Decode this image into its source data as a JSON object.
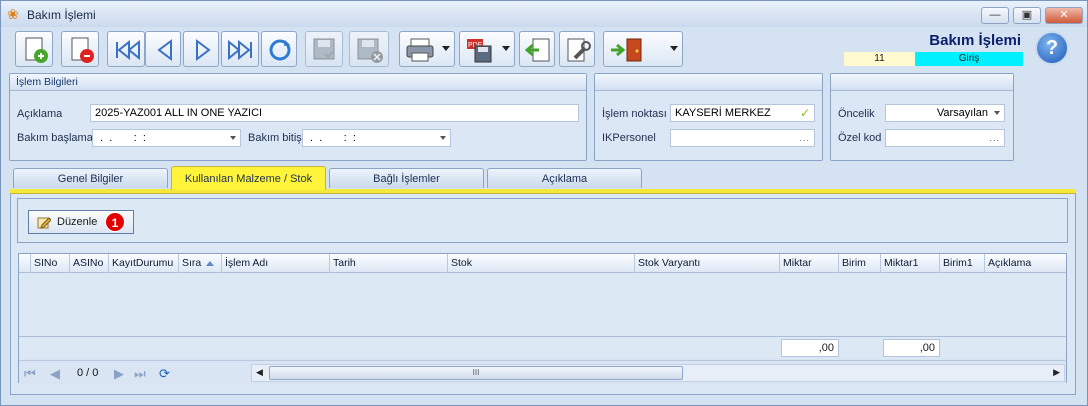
{
  "window": {
    "title": "Bakım İşlemi",
    "controls": [
      "minimize-icon",
      "maximize-icon",
      "close-icon"
    ]
  },
  "toolbar": {
    "buttons": [
      {
        "name": "new-record-button",
        "icon": "page-add-icon"
      },
      {
        "name": "delete-record-button",
        "icon": "page-delete-icon"
      },
      {
        "name": "first-record-button",
        "icon": "first-icon"
      },
      {
        "name": "previous-record-button",
        "icon": "previous-icon"
      },
      {
        "name": "next-record-button",
        "icon": "next-icon"
      },
      {
        "name": "last-record-button",
        "icon": "last-icon"
      },
      {
        "name": "refresh-button",
        "icon": "refresh-icon"
      },
      {
        "name": "save-button",
        "icon": "save-icon"
      },
      {
        "name": "save-close-button",
        "icon": "save-cancel-icon"
      },
      {
        "name": "print-button",
        "icon": "printer-icon"
      },
      {
        "name": "export-pdf-button",
        "icon": "pdf-icon"
      },
      {
        "name": "import-button",
        "icon": "import-icon"
      },
      {
        "name": "tools-button",
        "icon": "wrench-icon"
      },
      {
        "name": "exit-button",
        "icon": "exit-door-icon"
      }
    ]
  },
  "header": {
    "screen_name": "Bakım İşlemi",
    "record_id": "11",
    "record_status": "Giriş",
    "help_label": "?"
  },
  "islem_bilgileri": {
    "title": "İşlem Bilgileri",
    "aciklama_label": "Açıklama",
    "aciklama_value": "2025-YAZ001 ALL IN ONE YAZICI",
    "baslama_label": "Bakım başlama",
    "baslama_value": " .  .       :  :",
    "bitis_label": "Bakım bitiş",
    "bitis_value": " .  .       :  :"
  },
  "konum": {
    "islem_noktasi_label": "İşlem noktası",
    "islem_noktasi_value": "KAYSERİ MERKEZ",
    "ikpersonel_label": "IKPersonel",
    "ikpersonel_value": ""
  },
  "oncelik": {
    "oncelik_label": "Öncelik",
    "oncelik_value": "Varsayılan",
    "ozel_kod_label": "Özel kod",
    "ozel_kod_value": ""
  },
  "tabs": [
    {
      "label": "Genel Bilgiler"
    },
    {
      "label": "Kullanılan Malzeme / Stok"
    },
    {
      "label": "Bağlı İşlemler"
    },
    {
      "label": "Açıklama"
    }
  ],
  "edit": {
    "label": "Düzenle",
    "badge": "1"
  },
  "grid": {
    "columns": [
      "SINo",
      "ASINo",
      "KayıtDurumu",
      "Sıra",
      "İşlem Adı",
      "Tarih",
      "Stok",
      "Stok Varyantı",
      "Miktar",
      "Birim",
      "Miktar1",
      "Birim1",
      "Açıklama"
    ],
    "sum_miktar": ",00",
    "sum_miktar1": ",00",
    "pager": "0 / 0",
    "scroll_grip": "III"
  }
}
